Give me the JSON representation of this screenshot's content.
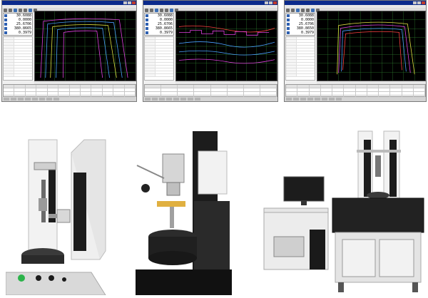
{
  "windows": [
    {
      "readout": [
        "30.6088",
        "0.0000",
        "25.6706",
        "380.8665",
        "0.3979"
      ],
      "plot_color": "#ff4040"
    },
    {
      "readout": [
        "30.6088",
        "0.0000",
        "25.6706",
        "380.8665",
        "0.3979"
      ],
      "plot_color": "#ff4040"
    },
    {
      "readout": [
        "30.6088",
        "0.0000",
        "25.6706",
        "380.8650",
        "0.3979"
      ],
      "plot_color": "#ff4040"
    }
  ],
  "colors": {
    "title_bar": "#0b2a8c",
    "plot_bg": "#000000",
    "grid": "#2e7d2e",
    "curve_blue": "#4aa0ff",
    "curve_magenta": "#e040e0",
    "curve_yellow": "#e0e040",
    "machine_white": "#f2f2f2",
    "machine_dark": "#1c1c1c"
  }
}
